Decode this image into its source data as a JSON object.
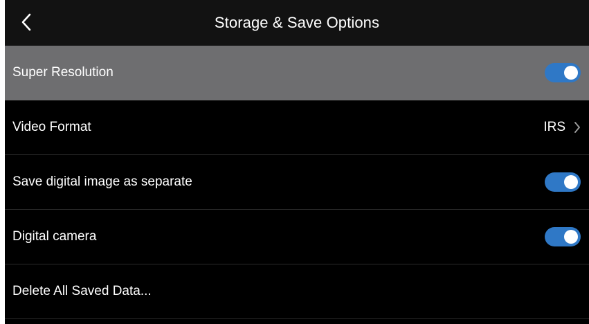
{
  "header": {
    "title": "Storage & Save Options",
    "back_icon": "chevron-left-icon"
  },
  "settings": [
    {
      "label": "Super Resolution",
      "control": "toggle",
      "checked": true,
      "highlighted": true
    },
    {
      "label": "Video Format",
      "control": "value",
      "value": "IRS",
      "icon": "chevron-right-icon"
    },
    {
      "label": "Save digital image as separate",
      "control": "toggle",
      "checked": true
    },
    {
      "label": "Digital camera",
      "control": "toggle",
      "checked": true
    },
    {
      "label": "Delete All Saved Data...",
      "control": "none"
    }
  ],
  "colors": {
    "background": "#000000",
    "header_bg": "#121212",
    "highlight_bg": "#6e6e70",
    "toggle_on": "#2f78c6",
    "text": "#ffffff"
  }
}
